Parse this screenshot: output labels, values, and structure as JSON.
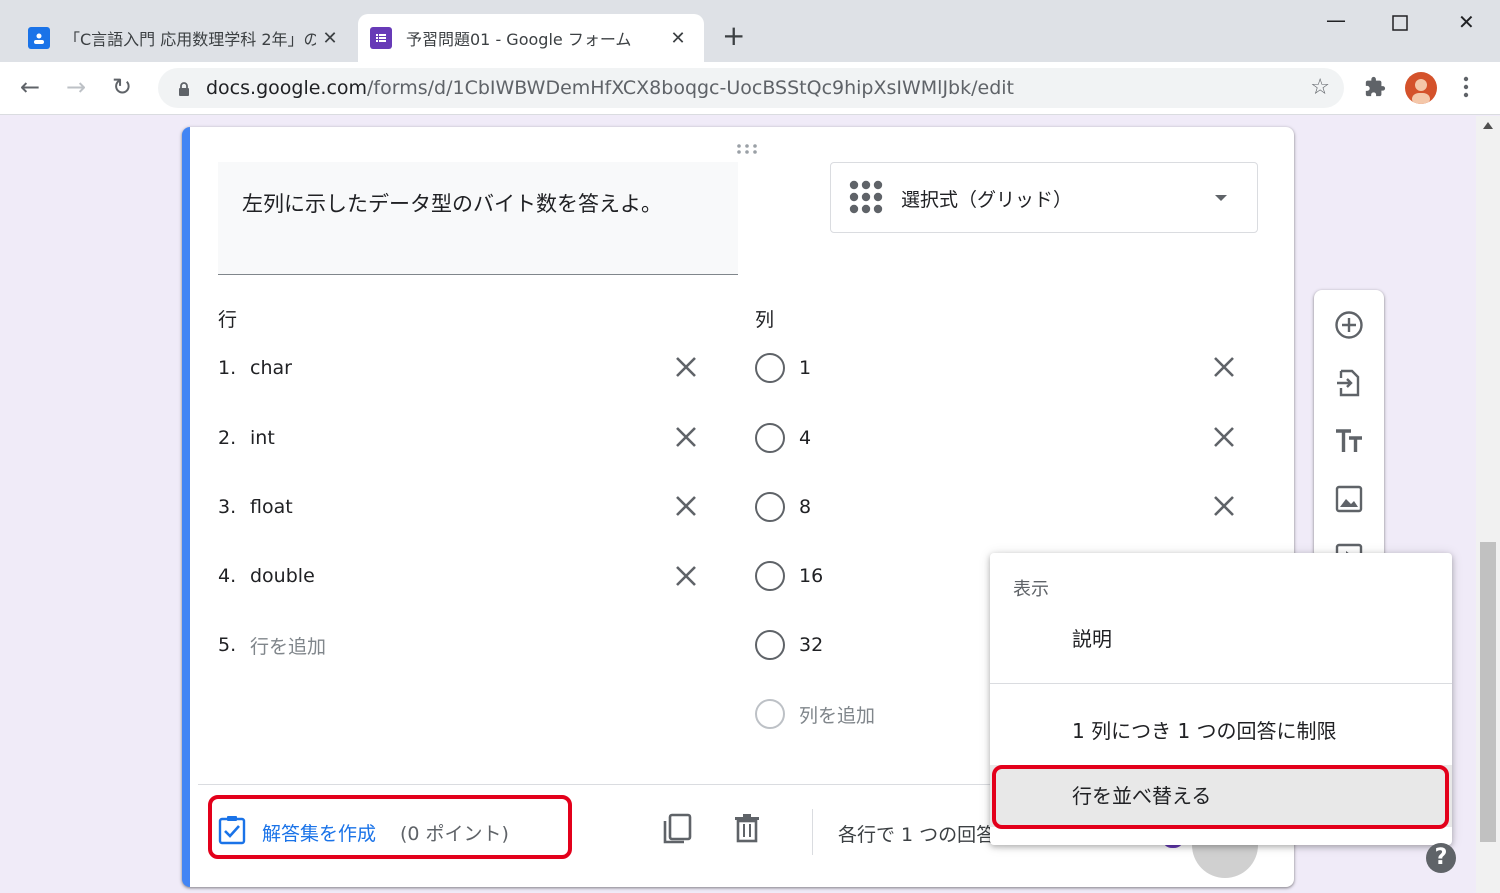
{
  "browser": {
    "tabs": [
      {
        "title": "「C言語入門 応用数理学科 2年」の",
        "favicon": "classroom-icon",
        "active": false
      },
      {
        "title": "予習問題01 - Google フォーム",
        "favicon": "forms-icon",
        "active": true
      }
    ],
    "new_tab": "+",
    "url_domain": "docs.google.com",
    "url_path": "/forms/d/1CbIWBWDemHfXCX8boqgc-UocBSStQc9hipXsIWMlJbk/edit"
  },
  "question": {
    "title": "左列に示したデータ型のバイト数を答えよ。",
    "type_label": "選択式（グリッド）",
    "rows_header": "行",
    "cols_header": "列",
    "rows": [
      {
        "num": "1.",
        "label": "char"
      },
      {
        "num": "2.",
        "label": "int"
      },
      {
        "num": "3.",
        "label": "float"
      },
      {
        "num": "4.",
        "label": "double"
      }
    ],
    "add_row": {
      "num": "5.",
      "label": "行を追加"
    },
    "columns": [
      "1",
      "4",
      "8",
      "16",
      "32"
    ],
    "add_column": "列を追加"
  },
  "footer": {
    "answer_key": "解答集を作成",
    "points": "(0 ポイント)",
    "require_text": "各行で 1 つの回答"
  },
  "menu": {
    "header": "表示",
    "items": [
      "説明",
      "1 列につき 1 つの回答に制限",
      "行を並べ替える"
    ]
  },
  "colors": {
    "accent": "#1a73e8",
    "highlight": "#e3001b",
    "form_bg": "#f0ebf8",
    "forms_purple": "#673ab7"
  }
}
